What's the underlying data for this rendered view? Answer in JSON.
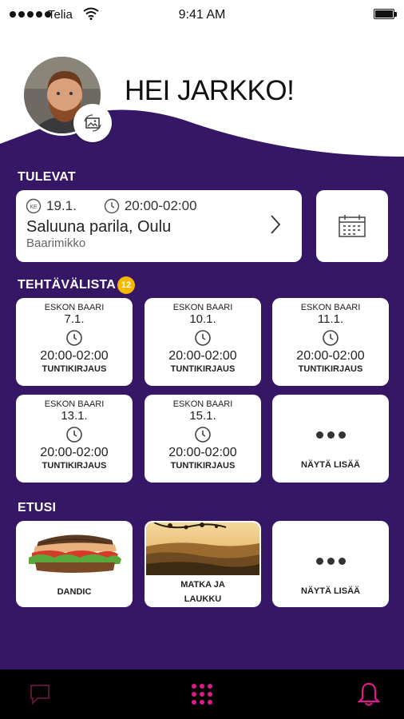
{
  "status_bar": {
    "carrier": "Telia",
    "time": "9:41 AM"
  },
  "header": {
    "greeting": "HEI JARKKO!"
  },
  "upcoming": {
    "title": "TULEVAT",
    "event": {
      "day_abbr": "KE",
      "date": "19.1.",
      "time": "20:00-02:00",
      "place": "Saluuna parila, Oulu",
      "role": "Baarimikko"
    }
  },
  "tasks": {
    "title": "TEHTÄVÄLISTA",
    "badge_count": "12",
    "items": [
      {
        "venue": "ESKON BAARI",
        "date": "7.1.",
        "hours": "20:00-02:00",
        "kind": "TUNTIKIRJAUS"
      },
      {
        "venue": "ESKON BAARI",
        "date": "10.1.",
        "hours": "20:00-02:00",
        "kind": "TUNTIKIRJAUS"
      },
      {
        "venue": "ESKON BAARI",
        "date": "11.1.",
        "hours": "20:00-02:00",
        "kind": "TUNTIKIRJAUS"
      },
      {
        "venue": "ESKON BAARI",
        "date": "13.1.",
        "hours": "20:00-02:00",
        "kind": "TUNTIKIRJAUS"
      },
      {
        "venue": "ESKON BAARI",
        "date": "15.1.",
        "hours": "20:00-02:00",
        "kind": "TUNTIKIRJAUS"
      }
    ],
    "more_label": "NÄYTÄ LISÄÄ"
  },
  "benefits": {
    "title": "ETUSI",
    "items": [
      {
        "label": "DANDIC",
        "image": "sandwich-image"
      },
      {
        "label_line1": "MATKA JA",
        "label_line2": "LAUKKU",
        "image": "landscape-image"
      }
    ],
    "more_label": "NÄYTÄ LISÄÄ"
  },
  "colors": {
    "brand_purple": "#351766",
    "accent_pink": "#e0198a",
    "badge_yellow": "#f5b800"
  },
  "tabbar": {
    "items": [
      "chat-icon",
      "grid-menu-icon",
      "bell-icon"
    ]
  }
}
